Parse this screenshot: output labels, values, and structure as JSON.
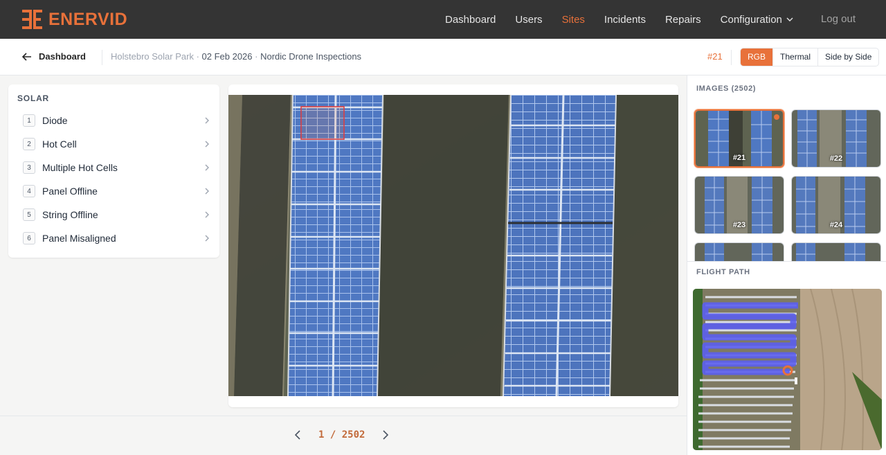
{
  "app": {
    "name": "ENERVID"
  },
  "nav": {
    "items": [
      {
        "label": "Dashboard",
        "active": false
      },
      {
        "label": "Users",
        "active": false
      },
      {
        "label": "Sites",
        "active": true
      },
      {
        "label": "Incidents",
        "active": false
      },
      {
        "label": "Repairs",
        "active": false
      },
      {
        "label": "Configuration",
        "active": false,
        "has_dropdown": true
      }
    ],
    "logout": "Log out"
  },
  "subheader": {
    "back_label": "Dashboard",
    "site": "Holstebro Solar Park",
    "date": "02 Feb 2026",
    "operator": "Nordic Drone Inspections",
    "sep": " · ",
    "current_image": "#21",
    "view_modes": [
      {
        "label": "RGB",
        "active": true
      },
      {
        "label": "Thermal",
        "active": false
      },
      {
        "label": "Side by Side",
        "active": false
      }
    ]
  },
  "categories": {
    "title": "SOLAR",
    "items": [
      {
        "key": "1",
        "label": "Diode"
      },
      {
        "key": "2",
        "label": "Hot Cell"
      },
      {
        "key": "3",
        "label": "Multiple Hot Cells"
      },
      {
        "key": "4",
        "label": "Panel Offline"
      },
      {
        "key": "5",
        "label": "String Offline"
      },
      {
        "key": "6",
        "label": "Panel Misaligned"
      }
    ]
  },
  "pager": {
    "text": "1 / 2502",
    "current": 1,
    "total": 2502
  },
  "images": {
    "title": "IMAGES (2502)",
    "thumbs": [
      {
        "label": "#21",
        "selected": true,
        "flagged": true
      },
      {
        "label": "#22",
        "selected": false,
        "flagged": false
      },
      {
        "label": "#23",
        "selected": false,
        "flagged": false
      },
      {
        "label": "#24",
        "selected": false,
        "flagged": false
      },
      {
        "label": "",
        "selected": false,
        "flagged": false
      },
      {
        "label": "",
        "selected": false,
        "flagged": false
      }
    ]
  },
  "flight_path": {
    "title": "FLIGHT PATH"
  },
  "colors": {
    "accent": "#e8713a",
    "topbar": "#343434",
    "path": "#5b5ef0"
  }
}
